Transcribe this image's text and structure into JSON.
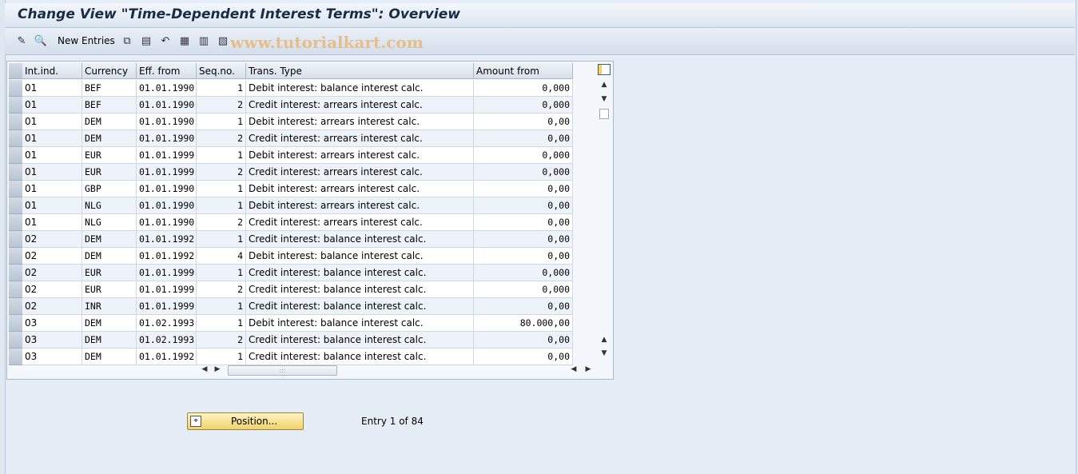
{
  "title": "Change View \"Time-Dependent Interest Terms\": Overview",
  "toolbar": {
    "new_entries_label": "New Entries",
    "watermark": "www.tutorialkart.com"
  },
  "table": {
    "columns": [
      "Int.ind.",
      "Currency",
      "Eff. from",
      "Seq.no.",
      "Trans. Type",
      "Amount from"
    ],
    "rows": [
      [
        "01",
        "BEF",
        "01.01.1990",
        "1",
        "Debit interest: balance interest calc.",
        "0,000"
      ],
      [
        "01",
        "BEF",
        "01.01.1990",
        "2",
        "Credit interest: arrears interest calc.",
        "0,000"
      ],
      [
        "01",
        "DEM",
        "01.01.1990",
        "1",
        "Debit interest: arrears interest calc.",
        "0,00"
      ],
      [
        "01",
        "DEM",
        "01.01.1990",
        "2",
        "Credit interest: arrears interest calc.",
        "0,00"
      ],
      [
        "01",
        "EUR",
        "01.01.1999",
        "1",
        "Debit interest: arrears interest calc.",
        "0,000"
      ],
      [
        "01",
        "EUR",
        "01.01.1999",
        "2",
        "Credit interest: arrears interest calc.",
        "0,000"
      ],
      [
        "01",
        "GBP",
        "01.01.1990",
        "1",
        "Debit interest: arrears interest calc.",
        "0,00"
      ],
      [
        "01",
        "NLG",
        "01.01.1990",
        "1",
        "Debit interest: arrears interest calc.",
        "0,00"
      ],
      [
        "01",
        "NLG",
        "01.01.1990",
        "2",
        "Credit interest: arrears interest calc.",
        "0,00"
      ],
      [
        "02",
        "DEM",
        "01.01.1992",
        "1",
        "Credit interest: balance interest calc.",
        "0,00"
      ],
      [
        "02",
        "DEM",
        "01.01.1992",
        "4",
        "Debit interest: balance interest calc.",
        "0,00"
      ],
      [
        "02",
        "EUR",
        "01.01.1999",
        "1",
        "Credit interest: balance interest calc.",
        "0,000"
      ],
      [
        "02",
        "EUR",
        "01.01.1999",
        "2",
        "Credit interest: balance interest calc.",
        "0,000"
      ],
      [
        "02",
        "INR",
        "01.01.1999",
        "1",
        "Credit interest: balance interest calc.",
        "0,00"
      ],
      [
        "03",
        "DEM",
        "01.02.1993",
        "1",
        "Debit interest: balance interest calc.",
        "80.000,00"
      ],
      [
        "03",
        "DEM",
        "01.02.1993",
        "2",
        "Credit interest: balance interest calc.",
        "0,00"
      ],
      [
        "03",
        "DEM",
        "01.01.1992",
        "1",
        "Credit interest: balance interest calc.",
        "0,00"
      ]
    ]
  },
  "position_button_label": "Position...",
  "entry_info": "Entry 1 of 84"
}
